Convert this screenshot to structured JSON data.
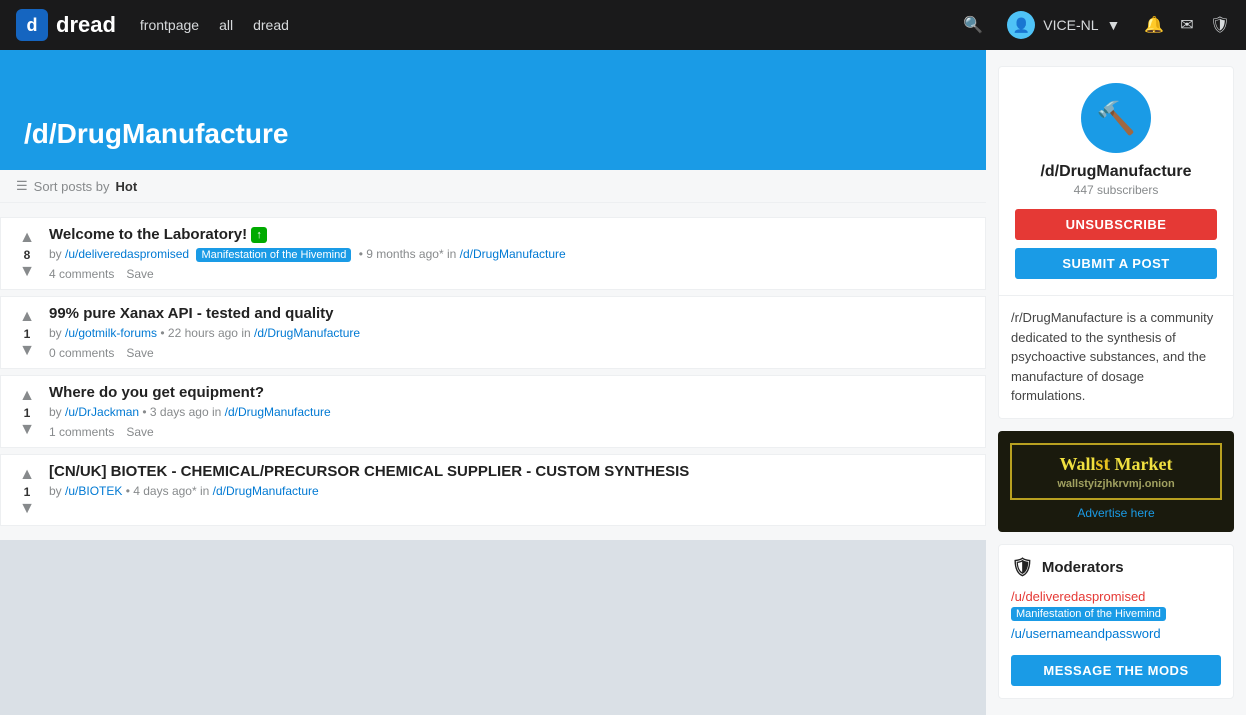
{
  "navbar": {
    "logo_letter": "d",
    "logo_name": "dread",
    "links": [
      "frontpage",
      "all",
      "dread"
    ],
    "username": "VICE-NL"
  },
  "subreddit": {
    "name": "/d/DrugManufacture",
    "subscribers": "447 subscribers",
    "description": "/r/DrugManufacture is a community dedicated to the synthesis of psychoactive substances, and the manufacture of dosage formulations.",
    "unsubscribe_label": "UNSUBSCRIBE",
    "submit_label": "SUBMIT A POST"
  },
  "sort_bar": {
    "prefix": "Sort posts by",
    "sort": "Hot"
  },
  "posts": [
    {
      "vote_count": "8",
      "title": "Welcome to the Laboratory!",
      "has_icon": true,
      "by": "/u/deliveredaspromised",
      "flair": "Manifestation of the Hivemind",
      "time": "9 months ago*",
      "sub": "/d/DrugManufacture",
      "comments": "4 comments",
      "save": "Save"
    },
    {
      "vote_count": "1",
      "title": "99% pure Xanax API - tested and quality",
      "has_icon": false,
      "by": "/u/gotmilk-forums",
      "flair": "",
      "time": "22 hours ago",
      "sub": "/d/DrugManufacture",
      "comments": "0 comments",
      "save": "Save"
    },
    {
      "vote_count": "1",
      "title": "Where do you get equipment?",
      "has_icon": false,
      "by": "/u/DrJackman",
      "flair": "",
      "time": "3 days ago",
      "sub": "/d/DrugManufacture",
      "comments": "1 comments",
      "save": "Save"
    },
    {
      "vote_count": "1",
      "title": "[CN/UK] BIOTEK - CHEMICAL/PRECURSOR CHEMICAL SUPPLIER - CUSTOM SYNTHESIS",
      "has_icon": false,
      "by": "/u/BIOTEK",
      "flair": "",
      "time": "4 days ago*",
      "sub": "/d/DrugManufacture",
      "comments": "",
      "save": ""
    }
  ],
  "ad": {
    "title": "Wall",
    "title_st": "st",
    "title_market": "Market",
    "url": "wallstyizjhkrvmj.onion",
    "advertise": "Advertise here"
  },
  "moderators": {
    "header": "Moderators",
    "mods": [
      {
        "name": "/u/deliveredaspromised",
        "flair": "Manifestation of the Hivemind",
        "color": "red"
      },
      {
        "name": "/u/usernameandpassword",
        "flair": "",
        "color": "blue"
      }
    ],
    "message_label": "MESSAGE THE MODS"
  }
}
